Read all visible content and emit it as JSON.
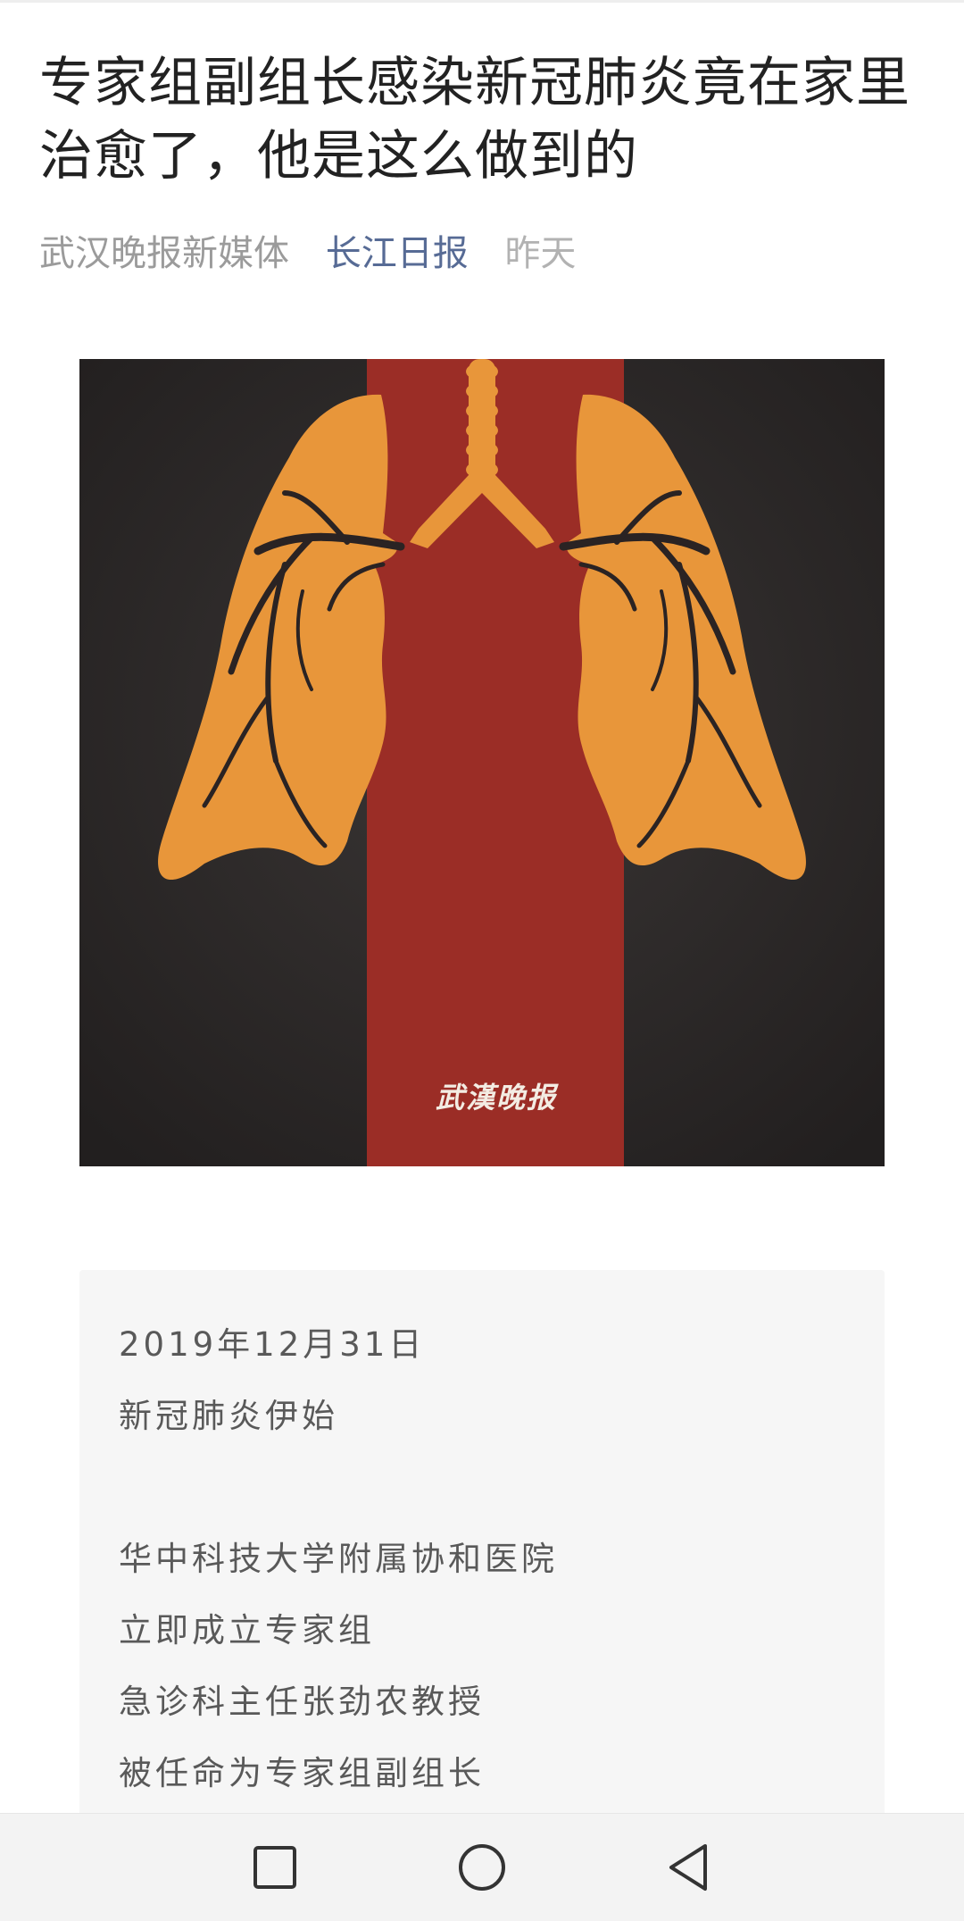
{
  "article": {
    "title": "专家组副组长感染新冠肺炎竟在家里治愈了，他是这么做到的",
    "author": "武汉晚报新媒体",
    "account": "长江日报",
    "time": "昨天"
  },
  "cover_image": {
    "watermark": "武漢晚报",
    "colors": {
      "background": "#2e2b2b",
      "stripe": "#9b2d26",
      "lungs": "#e8963a",
      "veins": "#2a2323"
    }
  },
  "quote_block": {
    "lines": [
      "2019年12月31日",
      "新冠肺炎伊始",
      "",
      "华中科技大学附属协和医院",
      "立即成立专家组",
      "急诊科主任张劲农教授",
      "被任命为专家组副组长"
    ]
  },
  "system_nav": {
    "buttons": [
      "recent-apps",
      "home",
      "back"
    ]
  }
}
